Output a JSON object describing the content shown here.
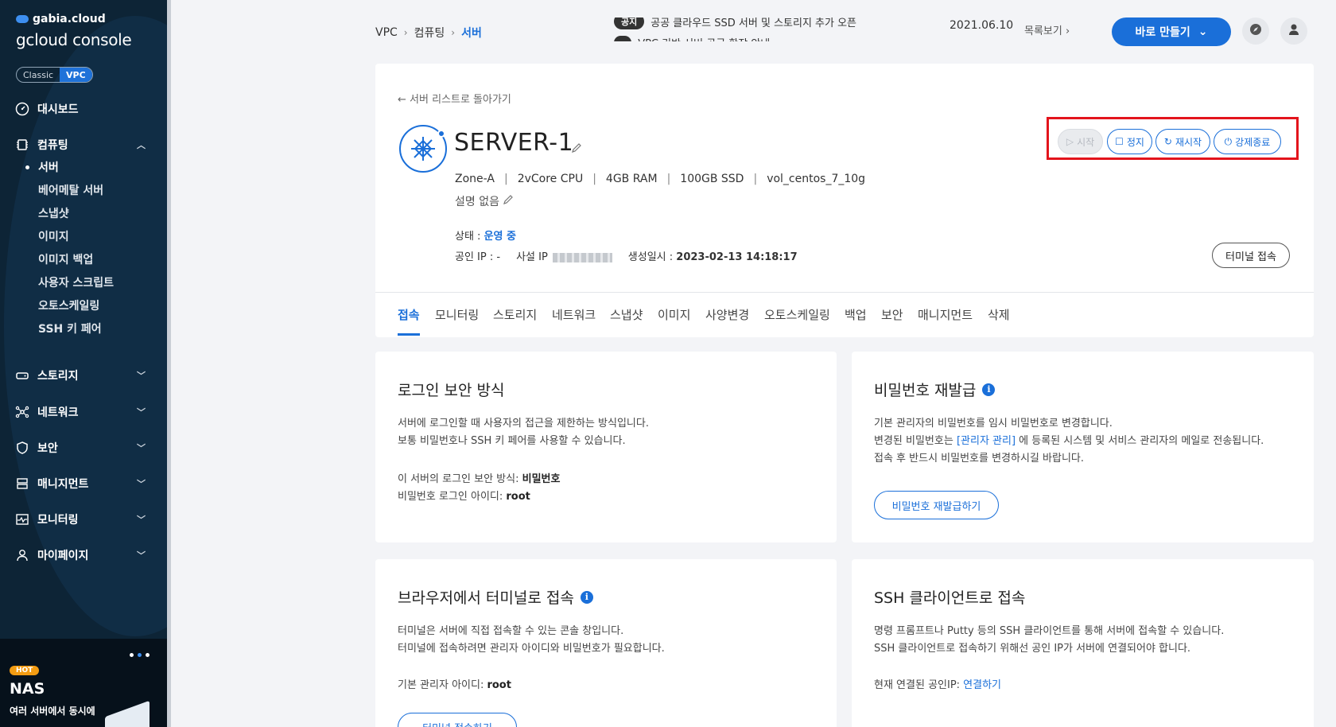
{
  "sidebar": {
    "brand_small": "gabia.cloud",
    "brand_big": "gcloud console",
    "mode_classic": "Classic",
    "mode_vpc": "VPC",
    "dashboard": "대시보드",
    "computing": "컴퓨팅",
    "sub_items": [
      "서버",
      "베어메탈 서버",
      "스냅샷",
      "이미지",
      "이미지 백업",
      "사용자 스크립트",
      "오토스케일링",
      "SSH 키 페어"
    ],
    "storage": "스토리지",
    "network": "네트워크",
    "security": "보안",
    "management": "매니지먼트",
    "monitoring": "모니터링",
    "mypage": "마이페이지",
    "promo_badge": "HOT",
    "promo_title": "NAS",
    "promo_desc": "여러 서버에서 동시에"
  },
  "topbar": {
    "breadcrumb": [
      "VPC",
      "컴퓨팅",
      "서버"
    ],
    "notice_tag": "공지",
    "notice_text": "공공 클라우드 SSD 서버 및 스토리지 추가 오픈",
    "notice_text2": "VPC 기반 서버 공급 확장 안내",
    "notice_date": "2021.06.10",
    "notice_more": "목록보기",
    "create_button": "바로 만들기"
  },
  "server": {
    "back_link": "서버 리스트로 돌아가기",
    "name": "SERVER-1",
    "zone": "Zone-A",
    "cpu": "2vCore CPU",
    "ram": "4GB RAM",
    "disk": "100GB SSD",
    "volume": "vol_centos_7_10g",
    "description": "설명 없음",
    "status_label": "상태 : ",
    "status_value": "운영 중",
    "public_ip": "공인 IP : -",
    "private_ip_label": "사설 IP",
    "created_label": "생성일시 : ",
    "created_value": "2023-02-13 14:18:17",
    "actions": {
      "start": "시작",
      "stop": "정지",
      "restart": "재시작",
      "force_stop": "강제종료"
    },
    "terminal_button": "터미널 접속"
  },
  "tabs": [
    "접속",
    "모니터링",
    "스토리지",
    "네트워크",
    "스냅샷",
    "이미지",
    "사양변경",
    "오토스케일링",
    "백업",
    "보안",
    "매니지먼트",
    "삭제"
  ],
  "login_security": {
    "title": "로그인 보안 방식",
    "desc1": "서버에 로그인할 때 사용자의 접근을 제한하는 방식입니다.",
    "desc2": "보통 비밀번호나 SSH 키 페어를 사용할 수 있습니다.",
    "method_label": "이 서버의 로그인 보안 방식: ",
    "method_value": "비밀번호",
    "id_label": "비밀번호 로그인 아이디: ",
    "id_value": "root"
  },
  "password_reset": {
    "title": "비밀번호 재발급",
    "desc1": "기본 관리자의 비밀번호를 임시 비밀번호로 변경합니다.",
    "desc2_pre": "변경된 비밀번호는 ",
    "desc2_link": "[관리자 관리]",
    "desc2_post": " 에 등록된 시스템 및 서비스 관리자의 메일로 전송됩니다.",
    "desc3": "접속 후 반드시 비밀번호를 변경하시길 바랍니다.",
    "button": "비밀번호 재발급하기"
  },
  "browser_terminal": {
    "title": "브라우저에서 터미널로 접속",
    "desc1": "터미널은 서버에 직접 접속할 수 있는 콘솔 창입니다.",
    "desc2": "터미널에 접속하려면 관리자 아이디와 비밀번호가 필요합니다.",
    "admin_label": "기본 관리자 아이디: ",
    "admin_value": "root",
    "button": "터미널 접속하기"
  },
  "ssh_client": {
    "title": "SSH 클라이언트로 접속",
    "desc1": "명령 프롬프트나 Putty 등의 SSH 클라이언트를 통해 서버에 접속할 수 있습니다.",
    "desc2": "SSH 클라이언트로 접속하기 위해선 공인 IP가 서버에 연결되어야 합니다.",
    "ip_label": "현재 연결된 공인IP: ",
    "ip_link": "연결하기"
  },
  "colors": {
    "accent": "#1a6fd9",
    "sidebar_bg": "#0d2436",
    "highlight_box": "#e3141c"
  }
}
